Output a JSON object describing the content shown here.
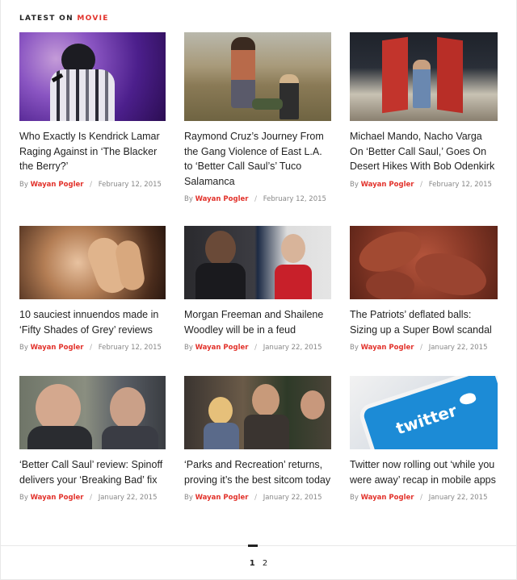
{
  "section": {
    "prefix": "LATEST ON",
    "category": "MOVIE"
  },
  "by_label": "By",
  "separator": "/",
  "articles": [
    {
      "image": "rapper-performing-photo",
      "title": "Who Exactly Is Kendrick Lamar Raging Against in ‘The Blacker the Berry?’",
      "author": "Wayan Pogler",
      "date": "February 12, 2015"
    },
    {
      "image": "desert-scene-photo",
      "title": "Raymond Cruz’s Journey From the Gang Violence of East L.A. to ‘Better Call Saul’s’ Tuco Salamanca",
      "author": "Wayan Pogler",
      "date": "February 12, 2015"
    },
    {
      "image": "van-doors-photo",
      "title": "Michael Mando, Nacho Varga On ‘Better Call Saul,’ Goes On Desert Hikes With Bob Odenkirk",
      "author": "Wayan Pogler",
      "date": "February 12, 2015"
    },
    {
      "image": "hands-photo",
      "title": "10 sauciest innuendos made in ‘Fifty Shades of Grey’ reviews",
      "author": "Wayan Pogler",
      "date": "February 12, 2015"
    },
    {
      "image": "morgan-freeman-shailene-photo",
      "title": "Morgan Freeman and Shailene Woodley will be in a feud",
      "author": "Wayan Pogler",
      "date": "January 22, 2015"
    },
    {
      "image": "footballs-photo",
      "title": "The Patriots’ deflated balls: Sizing up a Super Bowl scandal",
      "author": "Wayan Pogler",
      "date": "January 22, 2015"
    },
    {
      "image": "better-call-saul-photo",
      "title": "‘Better Call Saul’ review: Spinoff delivers your ‘Breaking Bad’ fix",
      "author": "Wayan Pogler",
      "date": "January 22, 2015"
    },
    {
      "image": "parks-recreation-photo",
      "title": "‘Parks and Recreation’ returns, proving it’s the best sitcom today",
      "author": "Wayan Pogler",
      "date": "January 22, 2015"
    },
    {
      "image": "twitter-phone-photo",
      "title": "Twitter now rolling out ‘while you were away’ recap in mobile apps",
      "author": "Wayan Pogler",
      "date": "January 22, 2015"
    }
  ],
  "twitter_logo_text": "twitter",
  "pagination": {
    "pages": [
      "1",
      "2"
    ],
    "current": "1"
  }
}
